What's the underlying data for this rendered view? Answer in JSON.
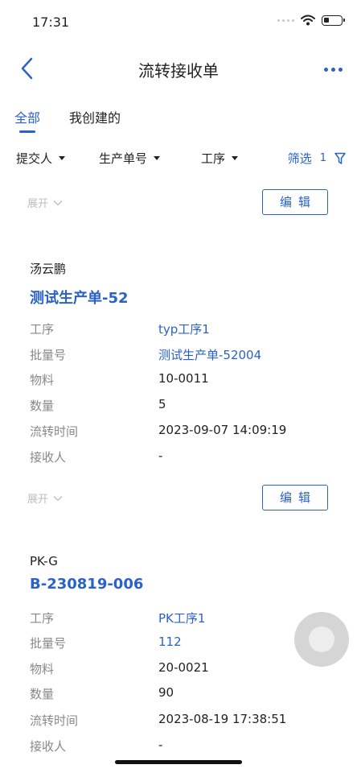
{
  "status_bar": {
    "time": "17:31"
  },
  "header": {
    "title": "流转接收单"
  },
  "tabs": [
    {
      "label": "全部",
      "active": true
    },
    {
      "label": "我创建的",
      "active": false
    }
  ],
  "filters": {
    "items": [
      "提交人",
      "生产单号",
      "工序"
    ],
    "screen_label": "筛选",
    "screen_count": "1"
  },
  "card_actions": {
    "expand_label": "展开",
    "edit_label": "编辑"
  },
  "field_labels": {
    "process": "工序",
    "batch_no": "批量号",
    "material": "物料",
    "quantity": "数量",
    "transfer_time": "流转时间",
    "receiver": "接收人"
  },
  "records": [
    {
      "submitter": "汤云鹏",
      "order_no": "测试生产单-52",
      "process": "typ工序1",
      "batch_no": "测试生产单-52004",
      "material": "10-0011",
      "quantity": "5",
      "transfer_time": "2023-09-07 14:09:19",
      "receiver": "-"
    },
    {
      "submitter": "PK-G",
      "order_no": "B-230819-006",
      "process": "PK工序1",
      "batch_no": "112",
      "material": "20-0021",
      "quantity": "90",
      "transfer_time": "2023-08-19 17:38:51",
      "receiver": "-"
    }
  ],
  "colors": {
    "accent": "#2a62c8",
    "text": "#222222",
    "label": "#888888",
    "muted": "#bdbdbd"
  },
  "icons": [
    "back-icon",
    "more-icon",
    "filter-funnel-icon",
    "chevron-down-icon",
    "wifi-icon",
    "battery-icon"
  ]
}
